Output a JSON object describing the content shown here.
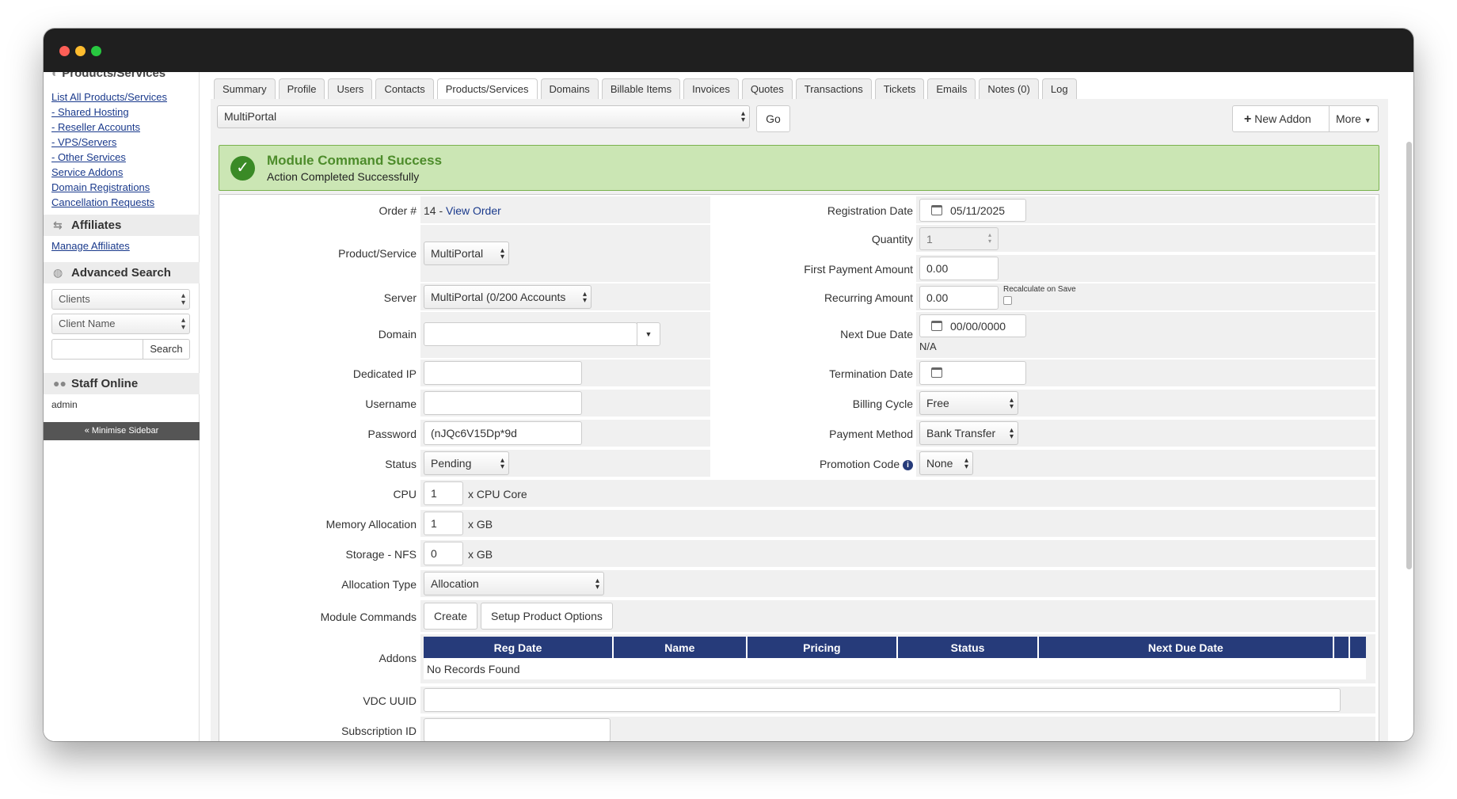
{
  "sidebar": {
    "cut_header": "Products/Services",
    "links": [
      "List All Products/Services",
      "- Shared Hosting",
      "- Reseller Accounts",
      "- VPS/Servers",
      "- Other Services",
      "Service Addons",
      "Domain Registrations",
      "Cancellation Requests"
    ],
    "affiliates_title": "Affiliates",
    "manage_affiliates": "Manage Affiliates",
    "advanced_search_title": "Advanced Search",
    "search_type": "Clients",
    "search_field": "Client Name",
    "search_button": "Search",
    "staff_online_title": "Staff Online",
    "staff_user": "admin",
    "minimise": "« Minimise Sidebar"
  },
  "tabs": [
    "Summary",
    "Profile",
    "Users",
    "Contacts",
    "Products/Services",
    "Domains",
    "Billable Items",
    "Invoices",
    "Quotes",
    "Transactions",
    "Tickets",
    "Emails",
    "Notes (0)",
    "Log"
  ],
  "active_tab": "Products/Services",
  "toolbar": {
    "product_select": "MultiPortal",
    "go": "Go",
    "new_addon": "New Addon",
    "more": "More"
  },
  "alert": {
    "title": "Module Command Success",
    "message": "Action Completed Successfully"
  },
  "form": {
    "order_label": "Order #",
    "order_number": "14 - ",
    "view_order": "View Order",
    "product_label": "Product/Service",
    "product_value": "MultiPortal",
    "server_label": "Server",
    "server_value": "MultiPortal (0/200 Accounts",
    "domain_label": "Domain",
    "domain_value": "",
    "dedicated_ip_label": "Dedicated IP",
    "username_label": "Username",
    "password_label": "Password",
    "password_value": "(nJQc6V15Dp*9d",
    "status_label": "Status",
    "status_value": "Pending",
    "reg_date_label": "Registration Date",
    "reg_date_value": "05/11/2025",
    "quantity_label": "Quantity",
    "quantity_value": "1",
    "first_payment_label": "First Payment Amount",
    "first_payment_value": "0.00",
    "recurring_label": "Recurring Amount",
    "recurring_value": "0.00",
    "recalc_label": "Recalculate on Save",
    "next_due_label": "Next Due Date",
    "next_due_value": "00/00/0000",
    "next_due_na": "N/A",
    "termination_label": "Termination Date",
    "billing_cycle_label": "Billing Cycle",
    "billing_cycle_value": "Free",
    "payment_method_label": "Payment Method",
    "payment_method_value": "Bank Transfer",
    "promo_label": "Promotion Code",
    "promo_value": "None",
    "cpu_label": "CPU",
    "cpu_value": "1",
    "cpu_suffix": "x CPU Core",
    "memory_label": "Memory Allocation",
    "memory_value": "1",
    "memory_suffix": "x GB",
    "storage_label": "Storage - NFS",
    "storage_value": "0",
    "storage_suffix": "x GB",
    "alloc_type_label": "Allocation Type",
    "alloc_type_value": "Allocation",
    "module_cmds_label": "Module Commands",
    "create_btn": "Create",
    "setup_btn": "Setup Product Options",
    "addons_label": "Addons",
    "addons_columns": [
      "Reg Date",
      "Name",
      "Pricing",
      "Status",
      "Next Due Date"
    ],
    "addons_empty": "No Records Found",
    "vdc_label": "VDC UUID",
    "subscription_label": "Subscription ID"
  }
}
